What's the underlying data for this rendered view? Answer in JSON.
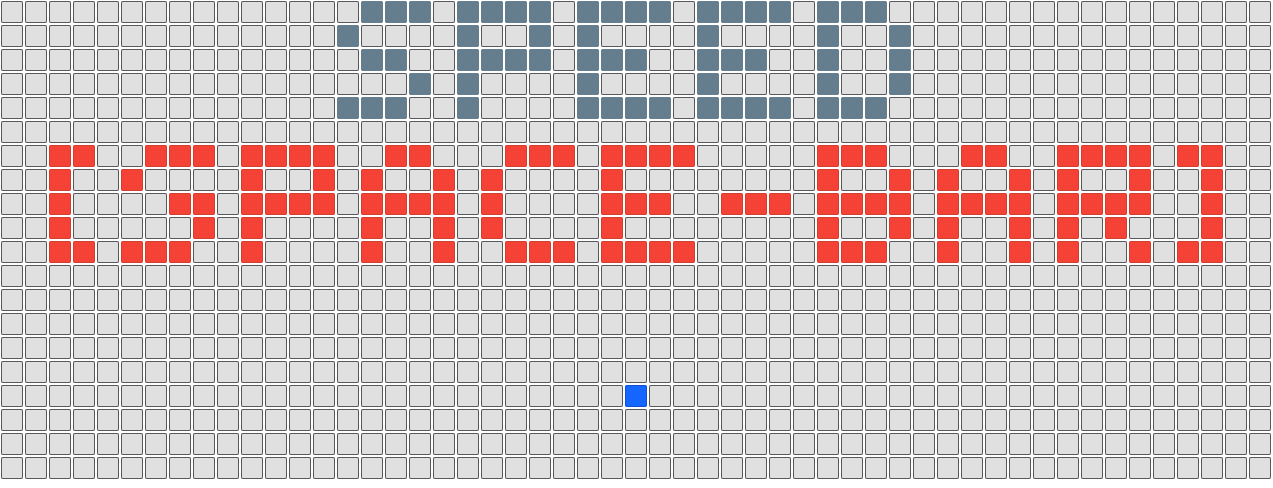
{
  "grid": {
    "columns": 53,
    "rows": 20
  },
  "colors": {
    "empty": "#e0e0e0",
    "grey": "#647e8e",
    "red": "#f44336",
    "blue": "#1565ff"
  },
  "patterns": {
    "top": [
      "...................................................",
      "...................................................",
      "...................................................",
      "...................................................",
      "..............###.####.####.####.###...............",
      ".............#.....#..#.#....#.....#..#............",
      "..............##..####.###..##....#..#.............",
      "................#.#....#....#.....#..#.............",
      ".............###..#....####.####.###...............",
      "..................................................."
    ]
  },
  "cells": {
    "grey": [
      [
        0,
        15
      ],
      [
        0,
        16
      ],
      [
        0,
        17
      ],
      [
        0,
        19
      ],
      [
        0,
        20
      ],
      [
        0,
        21
      ],
      [
        0,
        22
      ],
      [
        0,
        24
      ],
      [
        0,
        25
      ],
      [
        0,
        26
      ],
      [
        0,
        27
      ],
      [
        0,
        29
      ],
      [
        0,
        30
      ],
      [
        0,
        31
      ],
      [
        0,
        32
      ],
      [
        0,
        34
      ],
      [
        0,
        35
      ],
      [
        0,
        36
      ],
      [
        1,
        14
      ],
      [
        1,
        19
      ],
      [
        1,
        22
      ],
      [
        1,
        24
      ],
      [
        1,
        29
      ],
      [
        1,
        34
      ],
      [
        1,
        37
      ],
      [
        2,
        15
      ],
      [
        2,
        16
      ],
      [
        2,
        19
      ],
      [
        2,
        20
      ],
      [
        2,
        21
      ],
      [
        2,
        22
      ],
      [
        2,
        24
      ],
      [
        2,
        25
      ],
      [
        2,
        26
      ],
      [
        2,
        29
      ],
      [
        2,
        30
      ],
      [
        2,
        31
      ],
      [
        2,
        34
      ],
      [
        2,
        37
      ],
      [
        3,
        17
      ],
      [
        3,
        19
      ],
      [
        3,
        24
      ],
      [
        3,
        29
      ],
      [
        3,
        34
      ],
      [
        3,
        37
      ],
      [
        4,
        14
      ],
      [
        4,
        15
      ],
      [
        4,
        16
      ],
      [
        4,
        19
      ],
      [
        4,
        24
      ],
      [
        4,
        25
      ],
      [
        4,
        26
      ],
      [
        4,
        27
      ],
      [
        4,
        29
      ],
      [
        4,
        30
      ],
      [
        4,
        31
      ],
      [
        4,
        32
      ],
      [
        4,
        34
      ],
      [
        4,
        35
      ],
      [
        4,
        36
      ]
    ],
    "red": [
      [
        6,
        2
      ],
      [
        6,
        3
      ],
      [
        6,
        6
      ],
      [
        6,
        7
      ],
      [
        6,
        8
      ],
      [
        6,
        10
      ],
      [
        6,
        11
      ],
      [
        6,
        12
      ],
      [
        6,
        13
      ],
      [
        6,
        16
      ],
      [
        6,
        17
      ],
      [
        6,
        21
      ],
      [
        6,
        22
      ],
      [
        6,
        23
      ],
      [
        6,
        25
      ],
      [
        6,
        26
      ],
      [
        6,
        27
      ],
      [
        6,
        28
      ],
      [
        6,
        34
      ],
      [
        6,
        35
      ],
      [
        6,
        36
      ],
      [
        6,
        40
      ],
      [
        6,
        41
      ],
      [
        6,
        44
      ],
      [
        6,
        45
      ],
      [
        6,
        46
      ],
      [
        6,
        47
      ],
      [
        6,
        49
      ],
      [
        6,
        50
      ],
      [
        7,
        2
      ],
      [
        7,
        5
      ],
      [
        7,
        10
      ],
      [
        7,
        13
      ],
      [
        7,
        15
      ],
      [
        7,
        18
      ],
      [
        7,
        20
      ],
      [
        7,
        25
      ],
      [
        7,
        34
      ],
      [
        7,
        37
      ],
      [
        7,
        39
      ],
      [
        7,
        42
      ],
      [
        7,
        44
      ],
      [
        7,
        47
      ],
      [
        7,
        50
      ],
      [
        8,
        2
      ],
      [
        8,
        7
      ],
      [
        8,
        8
      ],
      [
        8,
        10
      ],
      [
        8,
        11
      ],
      [
        8,
        12
      ],
      [
        8,
        13
      ],
      [
        8,
        15
      ],
      [
        8,
        16
      ],
      [
        8,
        17
      ],
      [
        8,
        18
      ],
      [
        8,
        20
      ],
      [
        8,
        25
      ],
      [
        8,
        26
      ],
      [
        8,
        27
      ],
      [
        8,
        30
      ],
      [
        8,
        31
      ],
      [
        8,
        32
      ],
      [
        8,
        34
      ],
      [
        8,
        35
      ],
      [
        8,
        36
      ],
      [
        8,
        37
      ],
      [
        8,
        39
      ],
      [
        8,
        40
      ],
      [
        8,
        41
      ],
      [
        8,
        42
      ],
      [
        8,
        44
      ],
      [
        8,
        45
      ],
      [
        8,
        46
      ],
      [
        8,
        47
      ],
      [
        8,
        50
      ],
      [
        9,
        2
      ],
      [
        9,
        8
      ],
      [
        9,
        10
      ],
      [
        9,
        15
      ],
      [
        9,
        18
      ],
      [
        9,
        20
      ],
      [
        9,
        25
      ],
      [
        9,
        34
      ],
      [
        9,
        37
      ],
      [
        9,
        39
      ],
      [
        9,
        42
      ],
      [
        9,
        44
      ],
      [
        9,
        46
      ],
      [
        9,
        50
      ],
      [
        10,
        2
      ],
      [
        10,
        3
      ],
      [
        10,
        5
      ],
      [
        10,
        6
      ],
      [
        10,
        7
      ],
      [
        10,
        10
      ],
      [
        10,
        15
      ],
      [
        10,
        18
      ],
      [
        10,
        21
      ],
      [
        10,
        22
      ],
      [
        10,
        23
      ],
      [
        10,
        25
      ],
      [
        10,
        26
      ],
      [
        10,
        27
      ],
      [
        10,
        28
      ],
      [
        10,
        34
      ],
      [
        10,
        35
      ],
      [
        10,
        36
      ],
      [
        10,
        39
      ],
      [
        10,
        42
      ],
      [
        10,
        44
      ],
      [
        10,
        47
      ],
      [
        10,
        49
      ],
      [
        10,
        50
      ]
    ],
    "blue": [
      [
        16,
        26
      ]
    ]
  }
}
